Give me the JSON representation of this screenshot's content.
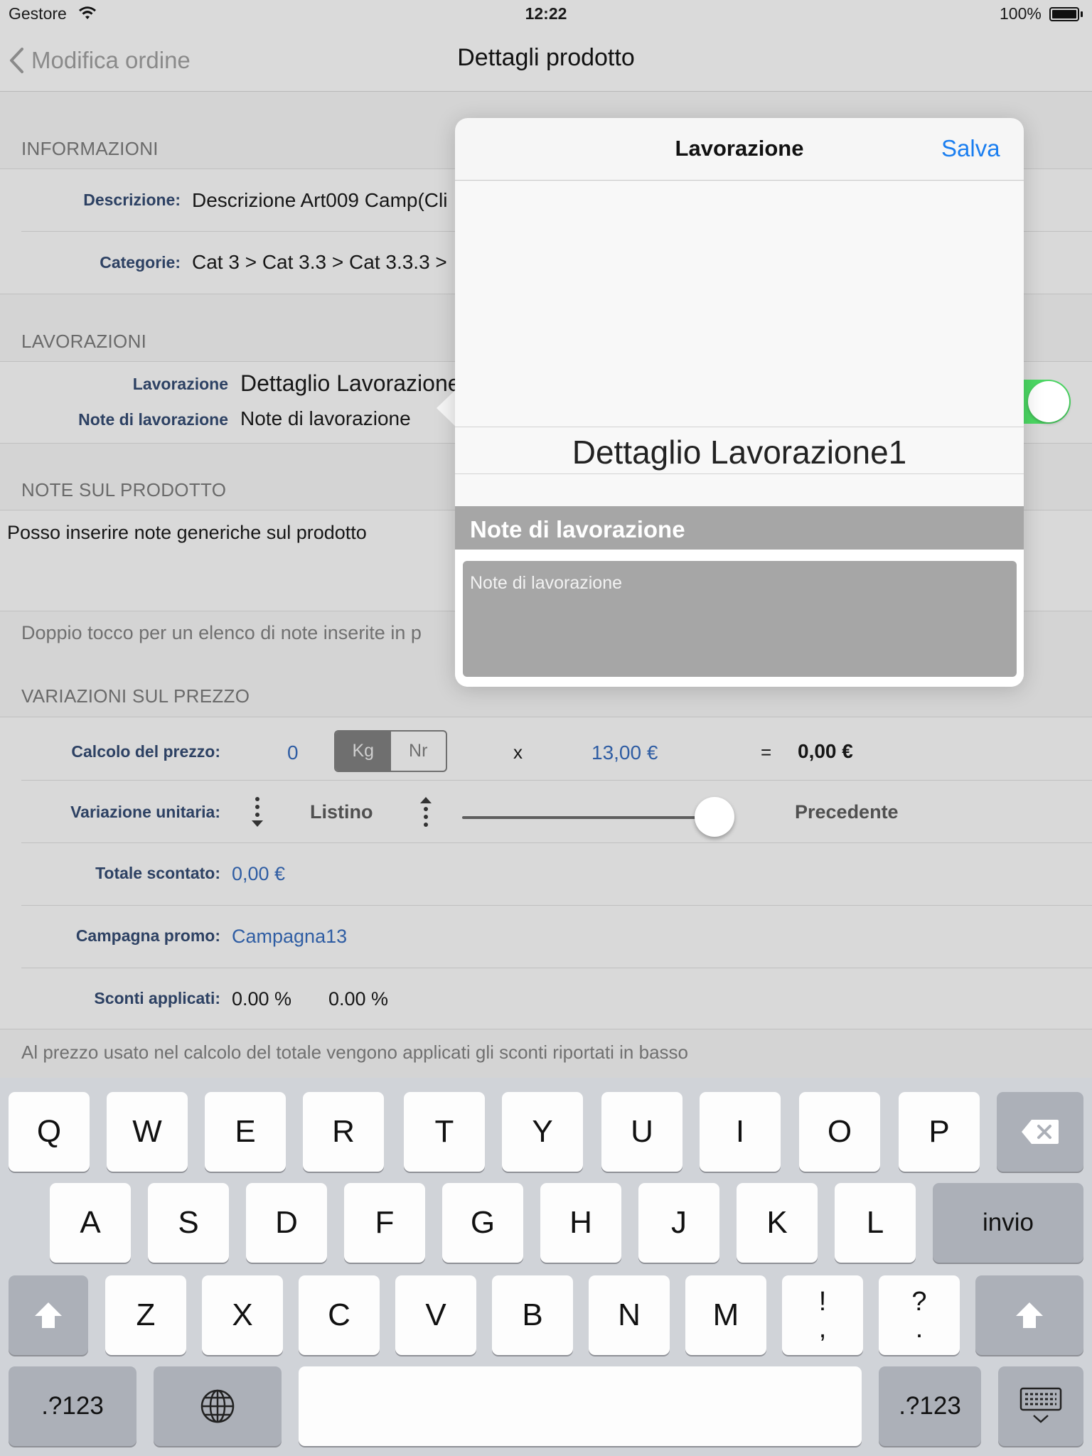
{
  "status_bar": {
    "carrier": "Gestore",
    "time": "12:22",
    "battery": "100%"
  },
  "nav": {
    "back_label": "Modifica ordine",
    "title": "Dettagli prodotto"
  },
  "informazioni": {
    "header": "INFORMAZIONI",
    "descrizione_label": "Descrizione:",
    "descrizione_value": "Descrizione Art009 Camp(Cli",
    "categorie_label": "Categorie:",
    "categorie_value": "Cat 3 > Cat 3.3 > Cat 3.3.3 >"
  },
  "lavorazioni": {
    "header": "LAVORAZIONI",
    "lavorazione_label": "Lavorazione",
    "lavorazione_value": "Dettaglio Lavorazione1",
    "note_label": "Note di lavorazione",
    "note_value": "Note di lavorazione",
    "toggle_on": true
  },
  "note_prodotto": {
    "header": "NOTE SUL PRODOTTO",
    "text": "Posso inserire note generiche sul prodotto",
    "footer": "Doppio tocco per un elenco di note inserite in p"
  },
  "variazioni": {
    "header": "VARIAZIONI SUL PREZZO",
    "calcolo_label": "Calcolo del prezzo:",
    "quantity": "0",
    "unit_kg": "Kg",
    "unit_nr": "Nr",
    "times": "x",
    "unit_price": "13,00 €",
    "equals": "=",
    "total": "0,00 €",
    "variazione_label": "Variazione unitaria:",
    "listino": "Listino",
    "precedente": "Precedente",
    "slider_fraction": 0.93,
    "totale_label": "Totale scontato:",
    "totale_value": "0,00 €",
    "campagna_label": "Campagna promo:",
    "campagna_value": "Campagna13",
    "sconti_label": "Sconti applicati:",
    "sconto1": "0.00 %",
    "sconto2": "0.00 %",
    "footer": "Al prezzo usato nel calcolo del totale vengono applicati gli sconti riportati in basso"
  },
  "popover": {
    "title": "Lavorazione",
    "save_label": "Salva",
    "picker_selected": "Dettaglio Lavorazione1",
    "notes_header": "Note di lavorazione",
    "notes_placeholder": "Note di lavorazione"
  },
  "keyboard": {
    "row1": [
      "Q",
      "W",
      "E",
      "R",
      "T",
      "Y",
      "U",
      "I",
      "O",
      "P"
    ],
    "row2": [
      "A",
      "S",
      "D",
      "F",
      "G",
      "H",
      "J",
      "K",
      "L"
    ],
    "row3": [
      "Z",
      "X",
      "C",
      "V",
      "B",
      "N",
      "M"
    ],
    "return_label": "invio",
    "numbers_label": ".?123",
    "punct1_top": "!",
    "punct1_bottom": ",",
    "punct2_top": "?",
    "punct2_bottom": "."
  },
  "colors": {
    "accent": "#1a7ef0",
    "link": "#2f5da3",
    "toggle": "#4cd964"
  }
}
